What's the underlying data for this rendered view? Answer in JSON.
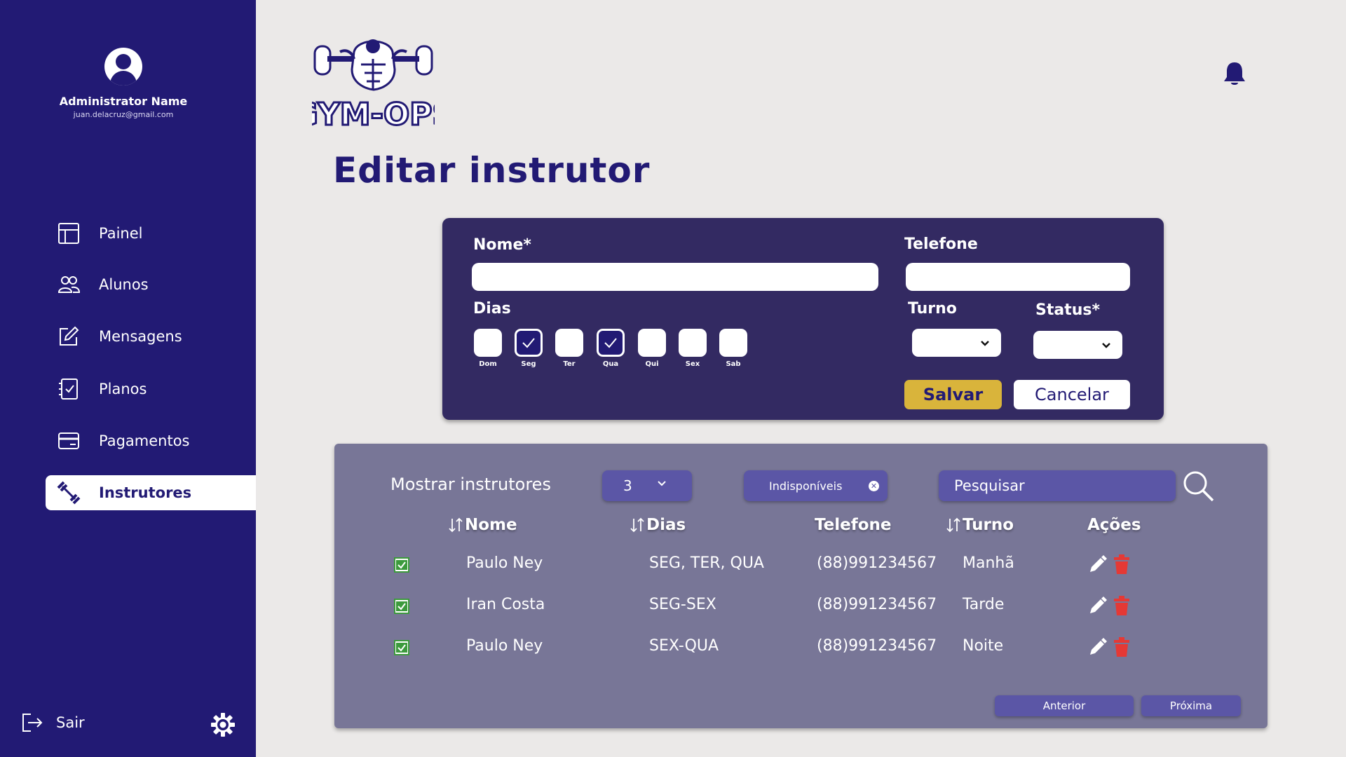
{
  "sidebar": {
    "admin_name": "Administrator Name",
    "admin_email": "juan.delacruz@gmail.com",
    "items": [
      {
        "label": "Painel",
        "icon": "layout-icon"
      },
      {
        "label": "Alunos",
        "icon": "users-icon"
      },
      {
        "label": "Mensagens",
        "icon": "edit-icon"
      },
      {
        "label": "Planos",
        "icon": "checklist-icon"
      },
      {
        "label": "Pagamentos",
        "icon": "card-icon"
      },
      {
        "label": "Instrutores",
        "icon": "dumbbell-icon",
        "active": true
      }
    ],
    "logout_label": "Sair"
  },
  "header": {
    "logo_text": "GYM-OPS",
    "page_title": "Editar instrutor"
  },
  "form": {
    "name_label": "Nome*",
    "name_value": "",
    "phone_label": "Telefone",
    "phone_value": "",
    "days_label": "Dias",
    "days": [
      {
        "label": "Dom",
        "checked": false
      },
      {
        "label": "Seg",
        "checked": true
      },
      {
        "label": "Ter",
        "checked": false
      },
      {
        "label": "Qua",
        "checked": true
      },
      {
        "label": "Qui",
        "checked": false
      },
      {
        "label": "Sex",
        "checked": false
      },
      {
        "label": "Sab",
        "checked": false
      }
    ],
    "shift_label": "Turno",
    "shift_value": "",
    "status_label": "Status*",
    "status_value": "",
    "save_label": "Salvar",
    "cancel_label": "Cancelar"
  },
  "table": {
    "show_label": "Mostrar instrutores",
    "show_count": "3",
    "filter_chip": "Indisponíveis",
    "search_placeholder": "Pesquisar",
    "columns": [
      "Nome",
      "Dias",
      "Telefone",
      "Turno",
      "Ações"
    ],
    "rows": [
      {
        "checked": true,
        "nome": "Paulo Ney",
        "dias": "SEG, TER, QUA",
        "telefone": "(88)991234567",
        "turno": "Manhã"
      },
      {
        "checked": true,
        "nome": "Iran Costa",
        "dias": "SEG-SEX",
        "telefone": "(88)991234567",
        "turno": "Tarde"
      },
      {
        "checked": true,
        "nome": "Paulo Ney",
        "dias": "SEX-QUA",
        "telefone": "(88)991234567",
        "turno": "Noite"
      }
    ],
    "prev_label": "Anterior",
    "next_label": "Próxima"
  },
  "colors": {
    "primary": "#221a74",
    "form_bg": "#332a62",
    "table_bg": "#787697",
    "accent": "#d9b43b",
    "delete": "#e53935",
    "check": "#3c9a3c"
  }
}
